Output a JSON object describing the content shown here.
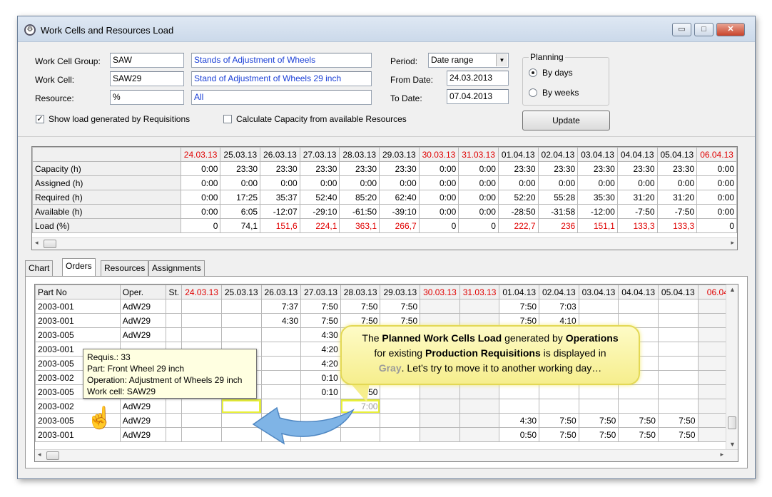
{
  "window": {
    "title": "Work Cells and Resources Load",
    "buttons": {
      "minimize": "▭",
      "maximize": "□",
      "close": "✕"
    }
  },
  "filters": {
    "work_cell_group": {
      "label": "Work Cell Group:",
      "code": "SAW",
      "description": "Stands of Adjustment of Wheels"
    },
    "work_cell": {
      "label": "Work Cell:",
      "code": "SAW29",
      "description": "Stand of Adjustment of Wheels 29 inch"
    },
    "resource": {
      "label": "Resource:",
      "code": "%",
      "description": "All"
    },
    "period": {
      "label": "Period:",
      "value": "Date range"
    },
    "from_date": {
      "label": "From Date:",
      "value": "24.03.2013"
    },
    "to_date": {
      "label": "To Date:",
      "value": "07.04.2013"
    },
    "planning": {
      "legend": "Planning",
      "by_days": "By days",
      "by_weeks": "By weeks",
      "selected": "By days"
    },
    "show_requisitions": {
      "label": "Show load generated by Requisitions",
      "checked": true,
      "mark": "✓"
    },
    "calc_capacity": {
      "label": "Calculate Capacity from available Resources",
      "checked": false
    },
    "update_button": "Update"
  },
  "summary": {
    "dates": [
      "24.03.13",
      "25.03.13",
      "26.03.13",
      "27.03.13",
      "28.03.13",
      "29.03.13",
      "30.03.13",
      "31.03.13",
      "01.04.13",
      "02.04.13",
      "03.04.13",
      "04.04.13",
      "05.04.13",
      "06.04.13"
    ],
    "red_dates": [
      0,
      6,
      7,
      13
    ],
    "rows": [
      {
        "label": "Capacity (h)",
        "values": [
          "0:00",
          "23:30",
          "23:30",
          "23:30",
          "23:30",
          "23:30",
          "0:00",
          "0:00",
          "23:30",
          "23:30",
          "23:30",
          "23:30",
          "23:30",
          "0:00"
        ]
      },
      {
        "label": "Assigned (h)",
        "values": [
          "0:00",
          "0:00",
          "0:00",
          "0:00",
          "0:00",
          "0:00",
          "0:00",
          "0:00",
          "0:00",
          "0:00",
          "0:00",
          "0:00",
          "0:00",
          "0:00"
        ]
      },
      {
        "label": "Required (h)",
        "values": [
          "0:00",
          "17:25",
          "35:37",
          "52:40",
          "85:20",
          "62:40",
          "0:00",
          "0:00",
          "52:20",
          "55:28",
          "35:30",
          "31:20",
          "31:20",
          "0:00"
        ]
      },
      {
        "label": "Available (h)",
        "values": [
          "0:00",
          "6:05",
          "-12:07",
          "-29:10",
          "-61:50",
          "-39:10",
          "0:00",
          "0:00",
          "-28:50",
          "-31:58",
          "-12:00",
          "-7:50",
          "-7:50",
          "0:00"
        ]
      },
      {
        "label": "Load (%)",
        "values": [
          "0",
          "74,1",
          "151,6",
          "224,1",
          "363,1",
          "266,7",
          "0",
          "0",
          "222,7",
          "236",
          "151,1",
          "133,3",
          "133,3",
          "0"
        ],
        "red": [
          2,
          3,
          4,
          5,
          8,
          9,
          10,
          11,
          12
        ]
      }
    ],
    "scroll_left": "◂",
    "scroll_right": "▸"
  },
  "tabs": [
    "Chart",
    "Orders",
    "Resources",
    "Assignments"
  ],
  "active_tab": "Orders",
  "orders": {
    "headers": {
      "part_no": "Part No",
      "oper": "Oper.",
      "st": "St."
    },
    "dates": [
      "24.03.13",
      "25.03.13",
      "26.03.13",
      "27.03.13",
      "28.03.13",
      "29.03.13",
      "30.03.13",
      "31.03.13",
      "01.04.13",
      "02.04.13",
      "03.04.13",
      "04.04.13",
      "05.04.13",
      "06.04"
    ],
    "rows": [
      {
        "part": "2003-001",
        "oper": "AdW29",
        "cells": [
          "",
          "",
          "7:37",
          "7:50",
          "7:50",
          "7:50",
          "",
          "",
          "7:50",
          "7:03",
          "",
          "",
          "",
          ""
        ]
      },
      {
        "part": "2003-001",
        "oper": "AdW29",
        "cells": [
          "",
          "",
          "4:30",
          "7:50",
          "7:50",
          "7:50",
          "",
          "",
          "7:50",
          "4:10",
          "",
          "",
          "",
          ""
        ]
      },
      {
        "part": "2003-005",
        "oper": "AdW29",
        "cells": [
          "",
          "",
          "",
          "4:30",
          "",
          "",
          "",
          "",
          "",
          "",
          "",
          "",
          "",
          ""
        ]
      },
      {
        "part": "2003-001",
        "oper": "",
        "cells": [
          "",
          "",
          "",
          "4:20",
          "",
          "",
          "",
          "",
          "",
          "",
          "",
          "",
          "",
          ""
        ]
      },
      {
        "part": "2003-005",
        "oper": "",
        "cells": [
          "",
          "",
          "",
          "4:20",
          "",
          "",
          "",
          "",
          "",
          "",
          "",
          "",
          "",
          ""
        ]
      },
      {
        "part": "2003-002",
        "oper": "",
        "cells": [
          "",
          "",
          "",
          "0:10",
          "",
          "",
          "",
          "",
          "",
          "",
          "",
          "",
          "",
          ""
        ]
      },
      {
        "part": "2003-005",
        "oper": "",
        "cells": [
          "",
          "",
          "",
          "0:10",
          "7:50",
          "",
          "",
          "",
          "",
          "",
          "",
          "",
          "",
          ""
        ]
      },
      {
        "part": "2003-002",
        "oper": "AdW29",
        "cells": [
          "",
          "",
          "",
          "",
          "7:00",
          "",
          "",
          "",
          "",
          "",
          "",
          "",
          "",
          ""
        ],
        "gray": true
      },
      {
        "part": "2003-005",
        "oper": "AdW29",
        "cells": [
          "",
          "",
          "",
          "",
          "",
          "",
          "",
          "",
          "4:30",
          "7:50",
          "7:50",
          "7:50",
          "7:50",
          ""
        ]
      },
      {
        "part": "2003-001",
        "oper": "AdW29",
        "cells": [
          "",
          "",
          "",
          "",
          "",
          "",
          "",
          "",
          "0:50",
          "7:50",
          "7:50",
          "7:50",
          "7:50",
          ""
        ]
      }
    ]
  },
  "tooltip": {
    "requis": "Requis.: 33",
    "part": "Part: Front Wheel 29 inch",
    "operation": "Operation: Adjustment of Wheels 29 inch",
    "work_cell": "Work cell: SAW29"
  },
  "callout": {
    "t1": "The ",
    "b1": "Planned Work Cells Load",
    "t2": " generated by ",
    "b2": "Operations",
    "t3": "for existing ",
    "b3": "Production Requisitions",
    "t4": " is displayed in",
    "gray_word": "Gray",
    "t5": ". Let’s try to move it to another working day…"
  },
  "colors": {
    "red": "#e00000",
    "callout_bg": "#f6ee8d",
    "highlight": "#e8ef3a",
    "arrow": "#7fb4e6"
  }
}
